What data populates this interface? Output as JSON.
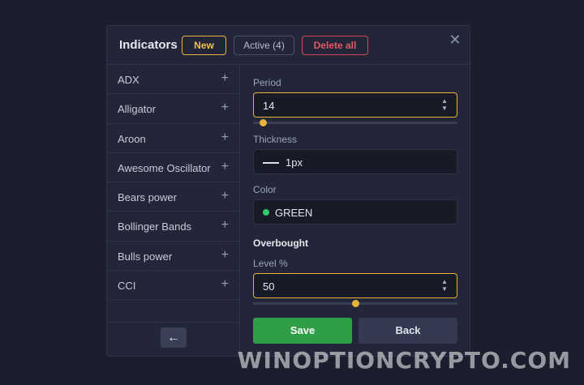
{
  "header": {
    "title": "Indicators",
    "tabs": {
      "new": "New",
      "active": "Active (4)",
      "delete_all": "Delete all"
    },
    "close_symbol": "✕"
  },
  "sidebar": {
    "items": [
      {
        "label": "ADX",
        "add": "+"
      },
      {
        "label": "Alligator",
        "add": "+"
      },
      {
        "label": "Aroon",
        "add": "+"
      },
      {
        "label": "Awesome Oscillator",
        "add": "+"
      },
      {
        "label": "Bears power",
        "add": "+"
      },
      {
        "label": "Bollinger Bands",
        "add": "+"
      },
      {
        "label": "Bulls power",
        "add": "+"
      },
      {
        "label": "CCI",
        "add": "+"
      }
    ],
    "back_symbol": "←"
  },
  "form": {
    "period": {
      "label": "Period",
      "value": "14",
      "slider_fraction": 0.05
    },
    "thickness": {
      "label": "Thickness",
      "value": "1px"
    },
    "color": {
      "label": "Color",
      "value": "GREEN",
      "swatch": "#35c76a"
    },
    "overbought": {
      "section": "Overbought",
      "label": "Level %",
      "value": "50",
      "slider_fraction": 0.5
    },
    "buttons": {
      "save": "Save",
      "back": "Back"
    }
  },
  "watermark": "WINOPTIONCRYPTO.COM",
  "colors": {
    "accent": "#e8b339",
    "danger": "#e25a65",
    "save": "#2f9e46"
  }
}
